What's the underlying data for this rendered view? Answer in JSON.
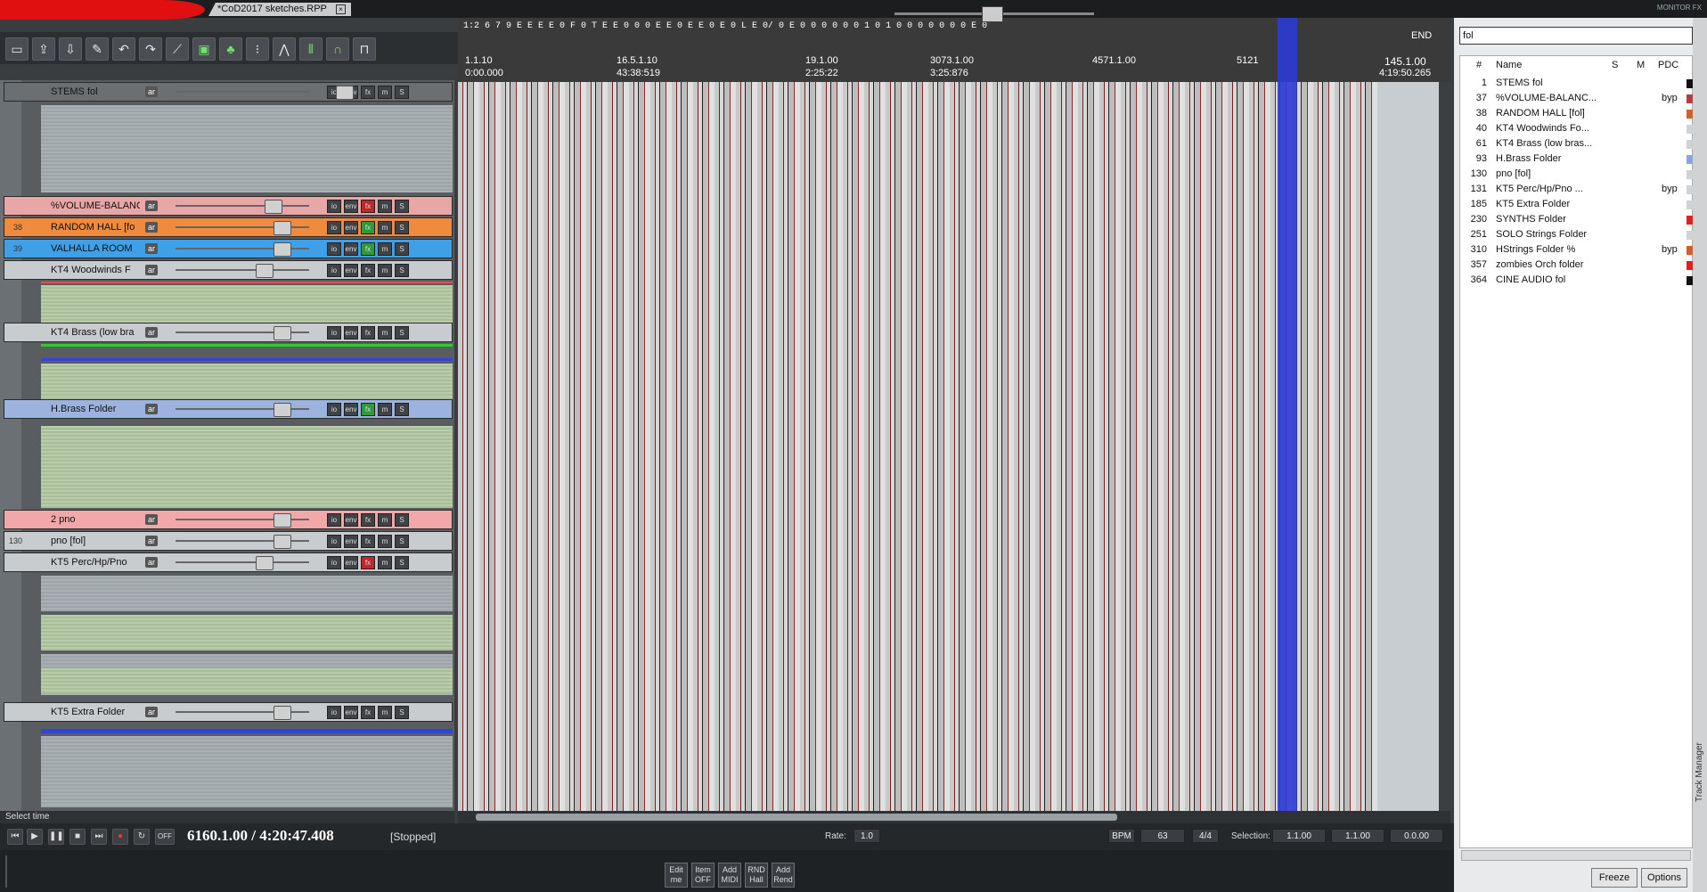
{
  "window": {
    "project_tab": "*CoD2017 sketches.RPP",
    "monitor_tag": "MONITOR FX"
  },
  "toolbar": {
    "icons": [
      "new-file-icon",
      "open-icon",
      "save-icon",
      "settings-icon",
      "undo-icon",
      "redo-icon",
      "metronome-icon",
      "midi-editor-icon",
      "grid-icon",
      "snap-icon",
      "ripple-icon",
      "bars-icon",
      "headphones-icon",
      "lock-icon"
    ]
  },
  "ruler": {
    "top_marks": "1:2 6 7 9 E E  E E 0 F 0 T E  E 0 0  0 E E 0   E E 0  E 0 L E 0/  0 E 0 0 0 0 0 0 1 0 1 0  0 0 0  0 0 0 E 0",
    "end_label": "END",
    "pos_left": "1.1.10",
    "pos_mid_1": "16.5.1.10",
    "pos_mid_2": "19.1.00",
    "pos_mid_3": "3073.1.00",
    "pos_mid_4": "4571.1.00",
    "pos_mid_5": "5121",
    "pos_end_1": "145.1.00",
    "pos_end_2": "4:19:50.265",
    "time_left": "0:00.000",
    "time_mid": "43:38:519",
    "time_mid2": "2:25:22",
    "time_mid3": "3:25:876"
  },
  "tracks": [
    {
      "num": "",
      "name": "STEMS fol",
      "color": "#6c6f72",
      "knob": "180px"
    },
    {
      "num": "",
      "name": "%VOLUME-BALANC",
      "color": "#e8a6a6",
      "knob": "100px"
    },
    {
      "num": "38",
      "name": "RANDOM HALL [fo",
      "color": "#f08a3c",
      "knob": "110px"
    },
    {
      "num": "39",
      "name": "VALHALLA ROOM",
      "color": "#3fa0e8",
      "knob": "110px"
    },
    {
      "num": "",
      "name": "KT4 Woodwinds F",
      "color": "#c8ccce",
      "knob": "90px"
    },
    {
      "num": "",
      "name": "KT4 Brass (low bra",
      "color": "#c8ccce",
      "knob": "110px"
    },
    {
      "num": "",
      "name": "H.Brass Folder",
      "color": "#9cb3e0",
      "knob": "110px"
    },
    {
      "num": "",
      "name": "2 pno",
      "color": "#f2a8a8",
      "knob": "110px"
    },
    {
      "num": "130",
      "name": "pno [fol]",
      "color": "#c8ccce",
      "knob": "110px"
    },
    {
      "num": "",
      "name": "KT5 Perc/Hp/Pno",
      "color": "#c8ccce",
      "knob": "90px"
    },
    {
      "num": "",
      "name": "KT5 Extra Folder",
      "color": "#c8ccce",
      "knob": "110px"
    }
  ],
  "track_buttons": {
    "io": "io",
    "env": "env",
    "fx": "fx",
    "mute": "m",
    "solo": "S",
    "arm": "ar"
  },
  "status": {
    "hint": "Select time"
  },
  "transport": {
    "position": "6160.1.00 / 4:20:47.408",
    "state": "[Stopped]",
    "rate_label": "Rate:",
    "rate_value": "1.0",
    "bpm_label": "BPM",
    "bpm_value": "63",
    "time_sig": "4/4",
    "selection_label": "Selection:",
    "sel_start": "1.1.00",
    "sel_end": "1.1.00",
    "sel_length": "0.0.00",
    "off_label": "OFF"
  },
  "actions": [
    {
      "label": "Edit\nme"
    },
    {
      "label": "Item\nOFF"
    },
    {
      "label": "Add\nMIDI"
    },
    {
      "label": "RND\nHall"
    },
    {
      "label": "Add\nRend"
    }
  ],
  "track_manager": {
    "search_value": "fol",
    "headers": {
      "num": "#",
      "name": "Name",
      "solo": "S",
      "mute": "M",
      "pdc": "PDC"
    },
    "rows": [
      {
        "num": "1",
        "name": "STEMS fol",
        "pdc": "",
        "color": "#111111"
      },
      {
        "num": "37",
        "name": "%VOLUME-BALANC...",
        "pdc": "byp",
        "color": "#b04040"
      },
      {
        "num": "38",
        "name": "RANDOM HALL [fol]",
        "pdc": "",
        "color": "#d0602a"
      },
      {
        "num": "40",
        "name": "KT4 Woodwinds Fo...",
        "pdc": "",
        "color": "#cfd3d5"
      },
      {
        "num": "61",
        "name": "KT4 Brass (low bras...",
        "pdc": "",
        "color": "#cfd3d5"
      },
      {
        "num": "93",
        "name": "H.Brass Folder",
        "pdc": "",
        "color": "#8aa4dc"
      },
      {
        "num": "130",
        "name": "pno [fol]",
        "pdc": "",
        "color": "#cfd3d5"
      },
      {
        "num": "131",
        "name": "KT5 Perc/Hp/Pno ...",
        "pdc": "byp",
        "color": "#cfd3d5"
      },
      {
        "num": "185",
        "name": "KT5 Extra Folder",
        "pdc": "",
        "color": "#cfd3d5"
      },
      {
        "num": "230",
        "name": "SYNTHS Folder",
        "pdc": "",
        "color": "#e02020"
      },
      {
        "num": "251",
        "name": "SOLO Strings Folder",
        "pdc": "",
        "color": "#cfd3d5"
      },
      {
        "num": "310",
        "name": "HStrings Folder %",
        "pdc": "byp",
        "color": "#d0602a"
      },
      {
        "num": "357",
        "name": "zombies Orch folder",
        "pdc": "",
        "color": "#e02020"
      },
      {
        "num": "364",
        "name": "CINE AUDIO fol",
        "pdc": "",
        "color": "#111111"
      }
    ],
    "freeze_label": "Freeze",
    "options_label": "Options",
    "side_label": "Track Manager"
  }
}
